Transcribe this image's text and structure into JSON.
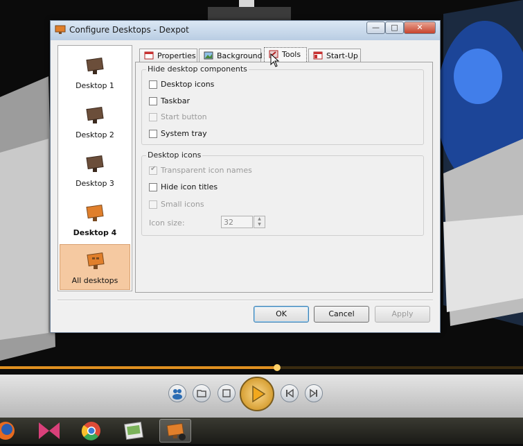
{
  "window": {
    "title": "Configure Desktops - Dexpot",
    "min_glyph": "—",
    "max_glyph": "□",
    "close_glyph": "✕"
  },
  "desktops": [
    {
      "label": "Desktop 1",
      "color": "#6b4e3a"
    },
    {
      "label": "Desktop 2",
      "color": "#6b4e3a"
    },
    {
      "label": "Desktop 3",
      "color": "#6b4e3a"
    },
    {
      "label": "Desktop 4",
      "color": "#e07f2b"
    },
    {
      "label": "All desktops",
      "color": "#e07f2b"
    }
  ],
  "tabs": [
    "Properties",
    "Background",
    "Tools",
    "Start-Up"
  ],
  "hide_group": {
    "legend": "Hide desktop components",
    "items": [
      "Desktop icons",
      "Taskbar",
      "Start button",
      "System tray"
    ]
  },
  "icons_group": {
    "legend": "Desktop icons",
    "items": [
      "Transparent icon names",
      "Hide icon titles",
      "Small icons"
    ],
    "size_label": "Icon size:",
    "size_value": "32"
  },
  "buttons": {
    "ok": "OK",
    "cancel": "Cancel",
    "apply": "Apply"
  },
  "player": {
    "progress": 0.53
  }
}
